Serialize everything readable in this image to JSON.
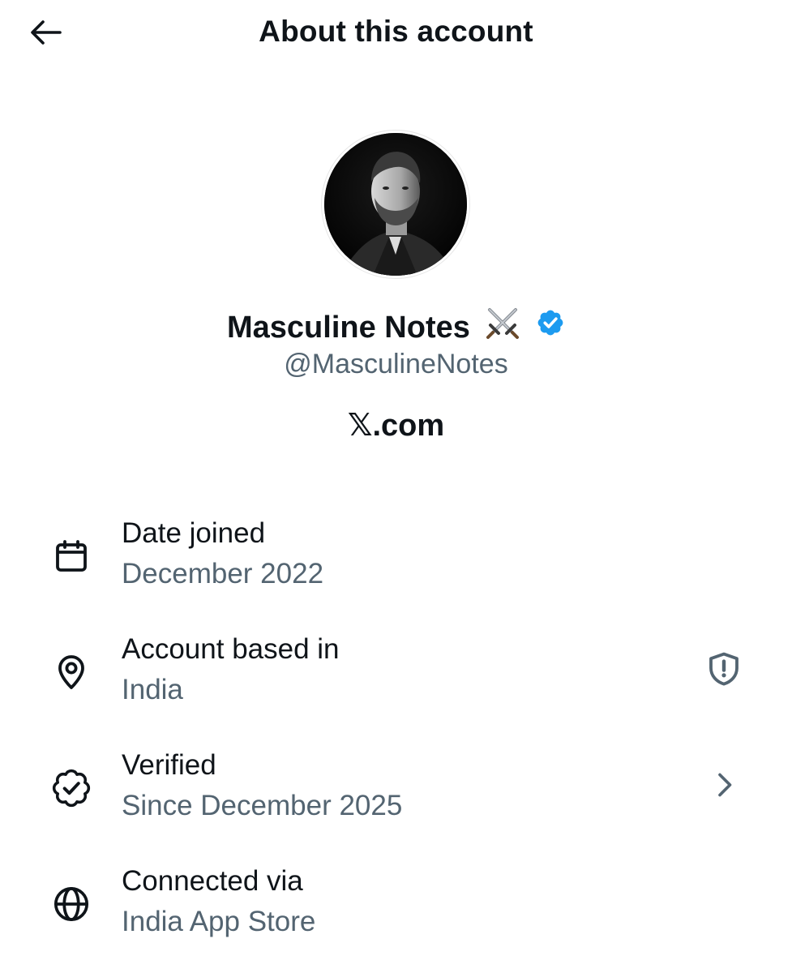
{
  "header": {
    "title": "About this account",
    "back_icon": "arrow-left-icon"
  },
  "profile": {
    "display_name": "Masculine Notes",
    "name_emoji": "crossed-swords-icon",
    "verified_badge": "verified-badge-icon",
    "verified_color": "#1d9bf0",
    "handle": "@MasculineNotes",
    "site": "𝕏.com"
  },
  "details": [
    {
      "icon": "calendar-icon",
      "label": "Date joined",
      "value": "December 2022",
      "trailing_icon": null
    },
    {
      "icon": "location-pin-icon",
      "label": "Account based in",
      "value": "India",
      "trailing_icon": "shield-alert-icon"
    },
    {
      "icon": "verified-outline-icon",
      "label": "Verified",
      "value": "Since December 2025",
      "trailing_icon": "chevron-right-icon"
    },
    {
      "icon": "globe-icon",
      "label": "Connected via",
      "value": "India App Store",
      "trailing_icon": null
    }
  ],
  "colors": {
    "text_primary": "#0f1419",
    "text_secondary": "#536471",
    "background": "#ffffff"
  }
}
